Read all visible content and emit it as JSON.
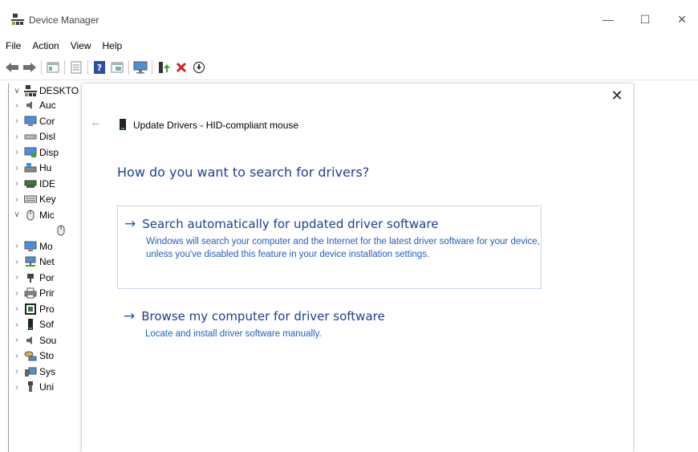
{
  "window": {
    "title": "Device Manager",
    "min_glyph": "—",
    "max_glyph": "☐",
    "close_glyph": "✕"
  },
  "menu": [
    "File",
    "Action",
    "View",
    "Help"
  ],
  "toolbar": [
    "back-icon",
    "forward-icon",
    "properties-icon",
    "list-view-icon",
    "help-icon",
    "resource-view-icon",
    "monitor-icon",
    "update-driver-icon",
    "uninstall-icon",
    "download-icon"
  ],
  "tree": {
    "root": "DESKTO",
    "items": [
      {
        "label": "Auc",
        "icon": "audio-icon",
        "expanded": false
      },
      {
        "label": "Cor",
        "icon": "computer-icon",
        "expanded": false
      },
      {
        "label": "Disl",
        "icon": "disk-icon",
        "expanded": false
      },
      {
        "label": "Disp",
        "icon": "display-icon",
        "expanded": false
      },
      {
        "label": "Hu",
        "icon": "hid-icon",
        "expanded": false
      },
      {
        "label": "IDE",
        "icon": "ide-icon",
        "expanded": false
      },
      {
        "label": "Key",
        "icon": "keyboard-icon",
        "expanded": false
      },
      {
        "label": "Mic",
        "icon": "mouse-icon",
        "expanded": true
      },
      {
        "label": "",
        "icon": "mouse-icon",
        "child": true
      },
      {
        "label": "Mo",
        "icon": "monitor-icon",
        "expanded": false
      },
      {
        "label": "Net",
        "icon": "network-icon",
        "expanded": false
      },
      {
        "label": "Por",
        "icon": "port-icon",
        "expanded": false
      },
      {
        "label": "Prir",
        "icon": "printer-icon",
        "expanded": false
      },
      {
        "label": "Pro",
        "icon": "processor-icon",
        "expanded": false
      },
      {
        "label": "Sof",
        "icon": "software-icon",
        "expanded": false
      },
      {
        "label": "Sou",
        "icon": "sound-icon",
        "expanded": false
      },
      {
        "label": "Sto",
        "icon": "storage-icon",
        "expanded": false
      },
      {
        "label": "Sys",
        "icon": "system-icon",
        "expanded": false
      },
      {
        "label": "Uni",
        "icon": "usb-icon",
        "expanded": false
      }
    ]
  },
  "dialog": {
    "close_glyph": "✕",
    "back_glyph": "←",
    "header_title": "Update Drivers - HID-compliant mouse",
    "question": "How do you want to search for drivers?",
    "arrow_glyph": "→",
    "options": [
      {
        "title": "Search automatically for updated driver software",
        "description": "Windows will search your computer and the Internet for the latest driver software for your device, unless you've disabled this feature in your device installation settings."
      },
      {
        "title": "Browse my computer for driver software",
        "description": "Locate and install driver software manually."
      }
    ]
  },
  "colors": {
    "link": "#1f3f8f",
    "link_desc": "#1f5fbf",
    "option_border": "#c7d8ee"
  }
}
